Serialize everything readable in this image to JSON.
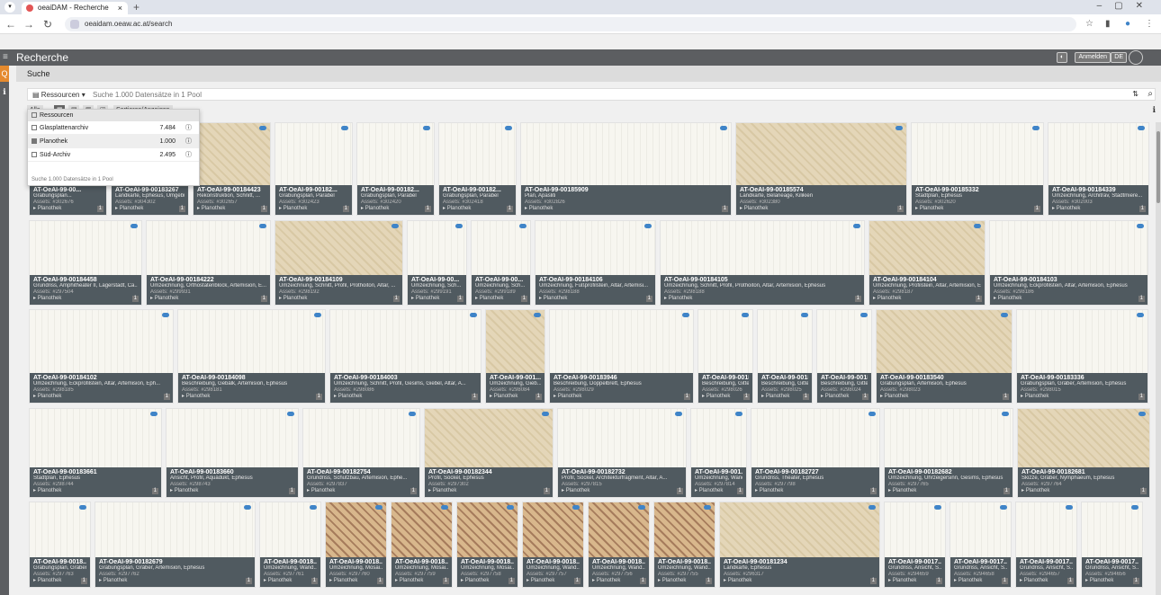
{
  "browser": {
    "tab_title": "oeaiDAM - Recherche",
    "url": "oeaidam.oeaw.ac.at/search"
  },
  "app": {
    "title": "Recherche",
    "login_label": "Anmelden",
    "lang_label": "DE",
    "subheader": "Suche"
  },
  "search": {
    "resources_label": "Ressourcen",
    "placeholder": "Suche 1.000 Datensätze in 1 Pool",
    "toolbar": [
      "Alle",
      "Sortieren/Anzeigen"
    ]
  },
  "dropdown": {
    "header": "Ressourcen",
    "items": [
      {
        "label": "Glasplattenarchiv",
        "count": "7.484",
        "checked": false
      },
      {
        "label": "Planothek",
        "count": "1.000",
        "checked": true
      },
      {
        "label": "Süd-Archiv",
        "count": "2.495",
        "checked": false
      }
    ],
    "footer": "Suche 1.000 Datensätze in 1 Pool"
  },
  "icons": [
    "hamburger-icon",
    "search-icon",
    "info-icon",
    "cloud-icon",
    "filter-icon",
    "star-icon",
    "close-icon",
    "plus-icon"
  ],
  "colors": {
    "accent": "#e58a2e",
    "meta_bg": "#505a60",
    "cloud": "#3f84c8",
    "appbar": "#5c5e61"
  },
  "cards": [
    {
      "row": 0,
      "title": "AT-OeAI-99-00...",
      "desc": "Grabungsplan...",
      "assets": "Assets: #302676",
      "pool": "Planothek",
      "n": "1"
    },
    {
      "row": 0,
      "title": "AT-OeAI-99-00183267",
      "desc": "Landkarte, Ephesus, Umgebung",
      "assets": "Assets: #304302",
      "pool": "Planothek",
      "n": "1"
    },
    {
      "row": 0,
      "title": "AT-OeAI-99-00184423",
      "desc": "Rekonstruktion, Schnitt, ...",
      "assets": "Assets: #302657",
      "pool": "Planothek",
      "n": "1"
    },
    {
      "row": 0,
      "title": "AT-OeAI-99-00182...",
      "desc": "Grabungsplan, Parabel",
      "assets": "Assets: #302423",
      "pool": "Planothek",
      "n": "1"
    },
    {
      "row": 0,
      "title": "AT-OeAI-99-00182...",
      "desc": "Grabungsplan, Parabel",
      "assets": "Assets: #302420",
      "pool": "Planothek",
      "n": "1"
    },
    {
      "row": 0,
      "title": "AT-OeAI-99-00182...",
      "desc": "Grabungsplan, Parabel",
      "assets": "Assets: #302418",
      "pool": "Planothek",
      "n": "1"
    },
    {
      "row": 0,
      "title": "AT-OeAI-99-00185909",
      "desc": "Plan, Apasliti",
      "assets": "Assets: #302826",
      "pool": "Planothek",
      "n": "1"
    },
    {
      "row": 0,
      "title": "AT-OeAI-99-00185574",
      "desc": "Landkarte, Belaneage, Kilikien",
      "assets": "Assets: #302380",
      "pool": "Planothek",
      "n": "1"
    },
    {
      "row": 0,
      "title": "AT-OeAI-99-00185332",
      "desc": "Stadtplan, Ephesus",
      "assets": "Assets: #302620",
      "pool": "Planothek",
      "n": "1"
    },
    {
      "row": 0,
      "title": "AT-OeAI-99-00184339",
      "desc": "Umzeichnung, Architrav, Stadtmiere...",
      "assets": "Assets: #302003",
      "pool": "Planothek",
      "n": "1"
    },
    {
      "row": 1,
      "title": "AT-OeAI-99-00184458",
      "desc": "Grundriss, Amphitheater II, Lagerstadt, Ca...",
      "assets": "Assets: #297504",
      "pool": "Planothek",
      "n": "1"
    },
    {
      "row": 1,
      "title": "AT-OeAI-99-00184222",
      "desc": "Umzeichnung, Orthostatenblock, Artemision, E...",
      "assets": "Assets: #299931",
      "pool": "Planothek",
      "n": "1"
    },
    {
      "row": 1,
      "title": "AT-OeAI-99-00184109",
      "desc": "Umzeichnung, Schnitt, Profil, Prothoiton, Altar, ...",
      "assets": "Assets: #298192",
      "pool": "Planothek",
      "n": "1"
    },
    {
      "row": 1,
      "title": "AT-OeAI-99-00...",
      "desc": "Umzeichnung, Sch...",
      "assets": "Assets: #299191",
      "pool": "Planothek",
      "n": "1"
    },
    {
      "row": 1,
      "title": "AT-OeAI-99-00...",
      "desc": "Umzeichnung, Sch...",
      "assets": "Assets: #299189",
      "pool": "Planothek",
      "n": "1"
    },
    {
      "row": 1,
      "title": "AT-OeAI-99-00184106",
      "desc": "Umzeichnung, Fußprofilstein, Altar, Artemisi...",
      "assets": "Assets: #298188",
      "pool": "Planothek",
      "n": "1"
    },
    {
      "row": 1,
      "title": "AT-OeAI-99-00184105",
      "desc": "Umzeichnung, Schnitt, Profil, Prothoiton, Altar, Artemision, Ephesus",
      "assets": "Assets: #298188",
      "pool": "Planothek",
      "n": "1"
    },
    {
      "row": 1,
      "title": "AT-OeAI-99-00184104",
      "desc": "Umzeichnung, Profilstein, Altar, Artemision, E...",
      "assets": "Assets: #298187",
      "pool": "Planothek",
      "n": "1"
    },
    {
      "row": 1,
      "title": "AT-OeAI-99-00184103",
      "desc": "Umzeichnung, Eckprofilstein, Altar, Artemision, Ephesus",
      "assets": "Assets: #298186",
      "pool": "Planothek",
      "n": "1"
    },
    {
      "row": 2,
      "title": "AT-OeAI-99-00184102",
      "desc": "Umzeichnung, Eckprofilstein, Altar, Artemision, Eph...",
      "assets": "Assets: #298185",
      "pool": "Planothek",
      "n": "1"
    },
    {
      "row": 2,
      "title": "AT-OeAI-99-00184098",
      "desc": "Beschreibung, Gebälk, Artemision, Ephesus",
      "assets": "Assets: #298181",
      "pool": "Planothek",
      "n": "1"
    },
    {
      "row": 2,
      "title": "AT-OeAI-99-00184003",
      "desc": "Umzeichnung, Schnitt, Profil, Gesims, Giebel, Altar, A...",
      "assets": "Assets: #298086",
      "pool": "Planothek",
      "n": "1"
    },
    {
      "row": 2,
      "title": "AT-OeAI-99-001...",
      "desc": "Umzeichnung, Gieb...",
      "assets": "Assets: #298084",
      "pool": "Planothek",
      "n": "1"
    },
    {
      "row": 2,
      "title": "AT-OeAI-99-00183946",
      "desc": "Beschreibung, Doppelbrett, Ephesus",
      "assets": "Assets: #298029",
      "pool": "Planothek",
      "n": "1"
    },
    {
      "row": 2,
      "title": "AT-OeAI-99-0018...",
      "desc": "Beschreibung, Gitter...",
      "assets": "Assets: #298026",
      "pool": "Planothek",
      "n": "1"
    },
    {
      "row": 2,
      "title": "AT-OeAI-99-0018...",
      "desc": "Beschreibung, Gitter...",
      "assets": "Assets: #298025",
      "pool": "Planothek",
      "n": "1"
    },
    {
      "row": 2,
      "title": "AT-OeAI-99-0018...",
      "desc": "Beschreibung, Gitter...",
      "assets": "Assets: #298024",
      "pool": "Planothek",
      "n": "1"
    },
    {
      "row": 2,
      "title": "AT-OeAI-99-00183540",
      "desc": "Grabungsplan, Artemision, Ephesus",
      "assets": "Assets: #298023",
      "pool": "Planothek",
      "n": "1"
    },
    {
      "row": 2,
      "title": "AT-OeAI-99-00183336",
      "desc": "Grabungsplan, Gräber, Artemision, Ephesus",
      "assets": "Assets: #298015",
      "pool": "Planothek",
      "n": "1"
    },
    {
      "row": 3,
      "title": "AT-OeAI-99-00183661",
      "desc": "Stadtplan, Ephesus",
      "assets": "Assets: #298744",
      "pool": "Planothek",
      "n": "1"
    },
    {
      "row": 3,
      "title": "AT-OeAI-99-00183660",
      "desc": "Ansicht, Profil, Aquädukt, Ephesus",
      "assets": "Assets: #298743",
      "pool": "Planothek",
      "n": "1"
    },
    {
      "row": 3,
      "title": "AT-OeAI-99-00182754",
      "desc": "Grundriss, Schutzbau, Artemision, Ephe...",
      "assets": "Assets: #297837",
      "pool": "Planothek",
      "n": "1"
    },
    {
      "row": 3,
      "title": "AT-OeAI-99-00182344",
      "desc": "Profil, Sockel, Ephesus",
      "assets": "Assets: #297302",
      "pool": "Planothek",
      "n": "1"
    },
    {
      "row": 3,
      "title": "AT-OeAI-99-00182732",
      "desc": "Profil, Sockel, Architekturfragment, Altar, A...",
      "assets": "Assets: #297815",
      "pool": "Planothek",
      "n": "1"
    },
    {
      "row": 3,
      "title": "AT-OeAI-99-001...",
      "desc": "Umzeichnung, Wand...",
      "assets": "Assets: #297814",
      "pool": "Planothek",
      "n": "1"
    },
    {
      "row": 3,
      "title": "AT-OeAI-99-00182727",
      "desc": "Grundriss, Theater, Ephesus",
      "assets": "Assets: #297798",
      "pool": "Planothek",
      "n": "1"
    },
    {
      "row": 3,
      "title": "AT-OeAI-99-00182682",
      "desc": "Umzeichnung, Uhrzeigersinn, Gesims, Ephesus",
      "assets": "Assets: #297765",
      "pool": "Planothek",
      "n": "1"
    },
    {
      "row": 3,
      "title": "AT-OeAI-99-00182681",
      "desc": "Skizze, Gräber, Nymphaeum, Ephesus",
      "assets": "Assets: #297764",
      "pool": "Planothek",
      "n": "1"
    },
    {
      "row": 4,
      "title": "AT-OeAI-99-0018...",
      "desc": "Grabungsplan, Gräber...",
      "assets": "Assets: #297763",
      "pool": "Planothek",
      "n": "1"
    },
    {
      "row": 4,
      "title": "AT-OeAI-99-00182679",
      "desc": "Grabungsplan, Gräber, Artemision, Ephesus",
      "assets": "Assets: #297762",
      "pool": "Planothek",
      "n": "1"
    },
    {
      "row": 4,
      "title": "AT-OeAI-99-0018...",
      "desc": "Umzeichnung, Wand...",
      "assets": "Assets: #297761",
      "pool": "Planothek",
      "n": "1"
    },
    {
      "row": 4,
      "title": "AT-OeAI-99-0018...",
      "desc": "Umzeichnung, Mosai...",
      "assets": "Assets: #297760",
      "pool": "Planothek",
      "n": "1"
    },
    {
      "row": 4,
      "title": "AT-OeAI-99-0018...",
      "desc": "Umzeichnung, Mosai...",
      "assets": "Assets: #297759",
      "pool": "Planothek",
      "n": "1"
    },
    {
      "row": 4,
      "title": "AT-OeAI-99-0018...",
      "desc": "Umzeichnung, Mosai...",
      "assets": "Assets: #297758",
      "pool": "Planothek",
      "n": "1"
    },
    {
      "row": 4,
      "title": "AT-OeAI-99-0018...",
      "desc": "Umzeichnung, Wand...",
      "assets": "Assets: #297757",
      "pool": "Planothek",
      "n": "1"
    },
    {
      "row": 4,
      "title": "AT-OeAI-99-0018...",
      "desc": "Umzeichnung, Wand...",
      "assets": "Assets: #297756",
      "pool": "Planothek",
      "n": "1"
    },
    {
      "row": 4,
      "title": "AT-OeAI-99-0018...",
      "desc": "Umzeichnung, Wand...",
      "assets": "Assets: #297755",
      "pool": "Planothek",
      "n": "1"
    },
    {
      "row": 4,
      "title": "AT-OeAI-99-00181234",
      "desc": "Landkarte, Ephesus",
      "assets": "Assets: #296317",
      "pool": "Planothek",
      "n": "1"
    },
    {
      "row": 4,
      "title": "AT-OeAI-99-0017...",
      "desc": "Grundriss, Ansicht, S...",
      "assets": "Assets: #294659",
      "pool": "Planothek",
      "n": "1"
    },
    {
      "row": 4,
      "title": "AT-OeAI-99-0017...",
      "desc": "Grundriss, Ansicht, S...",
      "assets": "Assets: #294658",
      "pool": "Planothek",
      "n": "1"
    },
    {
      "row": 4,
      "title": "AT-OeAI-99-0017...",
      "desc": "Grundriss, Ansicht, S...",
      "assets": "Assets: #294657",
      "pool": "Planothek",
      "n": "1"
    },
    {
      "row": 4,
      "title": "AT-OeAI-99-0017...",
      "desc": "Grundriss, Ansicht, S...",
      "assets": "Assets: #294656",
      "pool": "Planothek",
      "n": "1"
    }
  ]
}
